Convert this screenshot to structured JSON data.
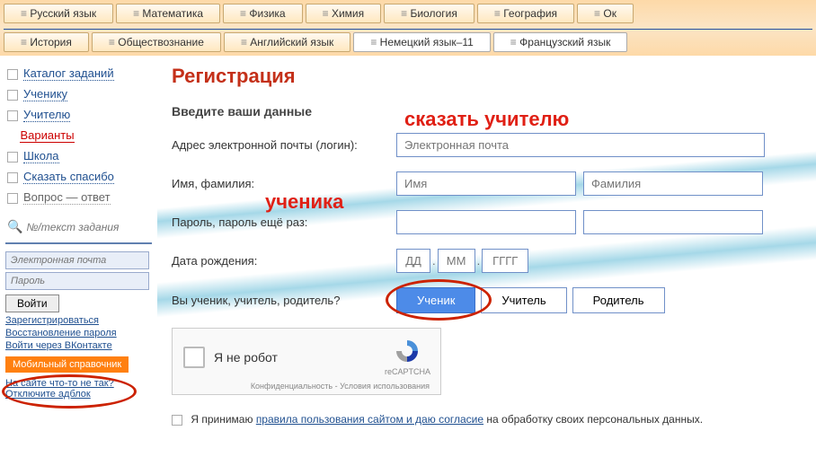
{
  "tabs_row1": [
    "Русский язык",
    "Математика",
    "Физика",
    "Химия",
    "Биология",
    "География",
    "Ок"
  ],
  "tabs_row2": [
    "История",
    "Обществознание",
    "Английский язык",
    "Немецкий язык–11",
    "Французский язык"
  ],
  "sidebar": {
    "items": [
      {
        "label": "Каталог заданий",
        "type": "check"
      },
      {
        "label": "Ученику",
        "type": "check"
      },
      {
        "label": "Учителю",
        "type": "check"
      },
      {
        "label": "Варианты",
        "type": "link",
        "active": true
      },
      {
        "label": "Школа",
        "type": "check"
      },
      {
        "label": "Сказать спасибо",
        "type": "check"
      },
      {
        "label": "Вопрос — ответ",
        "type": "check",
        "lite": true
      }
    ],
    "search_placeholder": "№/текст задания",
    "login": {
      "email_placeholder": "Электронная почта",
      "password_placeholder": "Пароль",
      "login_btn": "Войти",
      "register": "Зарегистрироваться",
      "restore": "Восстановление пароля",
      "vk": "Войти через ВКонтакте"
    },
    "mobile_btn": "Мобильный справочник",
    "footer1": "На сайте что-то не так?",
    "footer2": "Отключите адблок"
  },
  "page": {
    "title": "Регистрация",
    "subtitle": "Введите ваши данные",
    "email_label": "Адрес электронной почты (логин):",
    "email_placeholder": "Электронная почта",
    "name_label": "Имя, фамилия:",
    "name_placeholder": "Имя",
    "surname_placeholder": "Фамилия",
    "password_label": "Пароль, пароль ещё раз:",
    "dob_label": "Дата рождения:",
    "dd": "ДД",
    "mm": "ММ",
    "yyyy": "ГГГГ",
    "role_label": "Вы ученик, учитель, родитель?",
    "roles": [
      "Ученик",
      "Учитель",
      "Родитель"
    ],
    "captcha_label": "Я не робот",
    "captcha_brand": "reCAPTCHA",
    "captcha_links": "Конфиденциальность - Условия использования",
    "consent_prefix": "Я принимаю ",
    "consent_link": "правила пользования сайтом и даю согласие",
    "consent_suffix": " на обработку своих персональных данных."
  },
  "annotations": {
    "tell_teacher": "сказать учителю",
    "student": "ученика"
  }
}
